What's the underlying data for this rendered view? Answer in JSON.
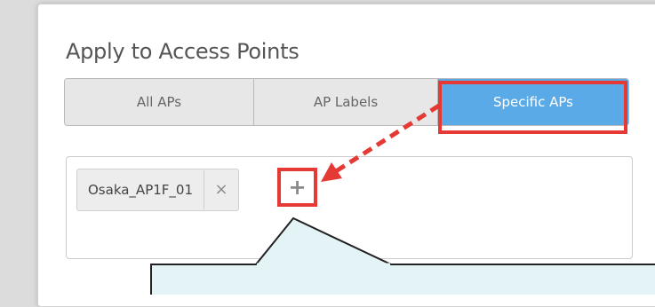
{
  "section": {
    "title": "Apply to Access Points"
  },
  "segments": [
    {
      "label": "All APs",
      "selected": false
    },
    {
      "label": "AP Labels",
      "selected": false
    },
    {
      "label": "Specific APs",
      "selected": true
    }
  ],
  "access_points": {
    "chips": [
      {
        "label": "Osaka_AP1F_01",
        "remove_symbol": "×"
      }
    ],
    "add_symbol": "+"
  },
  "colors": {
    "selected_segment": "#5aaae7",
    "highlight": "#e53935",
    "callout_fill": "#e4f3f5"
  }
}
